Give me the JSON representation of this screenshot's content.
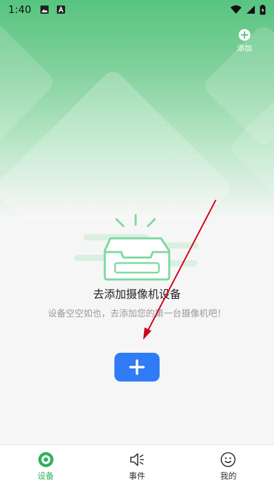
{
  "status_bar": {
    "time": "1:40"
  },
  "header": {
    "add_label": "添加"
  },
  "empty_state": {
    "title": "去添加摄像机设备",
    "description": "设备空空如也，去添加您的第一台摄像机吧！"
  },
  "nav": {
    "items": [
      {
        "label": "设备",
        "icon": "camera-icon",
        "active": true
      },
      {
        "label": "事件",
        "icon": "speaker-icon",
        "active": false
      },
      {
        "label": "我的",
        "icon": "smiley-icon",
        "active": false
      }
    ]
  },
  "colors": {
    "accent_green": "#2fb25c",
    "primary_blue": "#2f7cf6",
    "annotation_red": "#d0021b"
  }
}
